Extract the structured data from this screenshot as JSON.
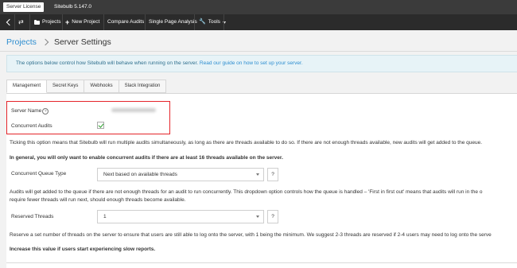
{
  "topbar": {
    "license_button": "Server License",
    "version": "Sitebulb 5.147.0"
  },
  "nav": {
    "back_label": "",
    "items": [
      {
        "label": "Projects",
        "icon": "folder-icon"
      },
      {
        "label": "New Project",
        "icon": "plus-icon"
      },
      {
        "label": "Compare Audits"
      },
      {
        "label": "Single Page Analysis"
      },
      {
        "label": "Tools",
        "icon": "wrench-icon"
      }
    ]
  },
  "breadcrumb": {
    "parent": "Projects",
    "current": "Server Settings"
  },
  "info": {
    "text": "The options below control how Sitebulb will behave when running on the server.",
    "link": "Read our guide on how to set up your server."
  },
  "tabs": [
    "Management",
    "Secret Keys",
    "Webhooks",
    "Slack Integration"
  ],
  "form": {
    "server_name_label": "Server Name",
    "help_glyph": "?",
    "concurrent_audits_label": "Concurrent Audits",
    "concurrent_audits_checked": true,
    "concurrent_desc": "Ticking this option means that Sitebulb will run multiple audits simultaneously, as long as there are threads available to do so. If there are not enough threads available, new audits will get added to the queue.",
    "concurrent_bold": "In general, you will only want to enable concurrent audits if there are at least 16 threads available on the server.",
    "queue_type_label": "Concurrent Queue Type",
    "queue_type_value": "Next based on available threads",
    "queue_desc_1": "Audits will get added to the queue if there are not enough threads for an audit to run concurrently. This dropdown option controls how the queue is handled – 'First in first out' means that audits will run in the o",
    "queue_desc_2": "require fewer threads will run next, should enough threads become available.",
    "reserved_label": "Reserved Threads",
    "reserved_value": "1",
    "reserved_desc": "Reserve a set number of threads on the server to ensure that users are still able to log onto the server, with 1 being the minimum. We suggest 2-3 threads are reserved if 2-4 users may need to log onto the serve",
    "reserved_bold": "Increase this value if users start experiencing slow reports.",
    "question_label": "?"
  },
  "colors": {
    "accent": "#2e8ed0",
    "highlight": "#e5242a",
    "check": "#2aa02a",
    "navbar": "#2b2b2b"
  }
}
